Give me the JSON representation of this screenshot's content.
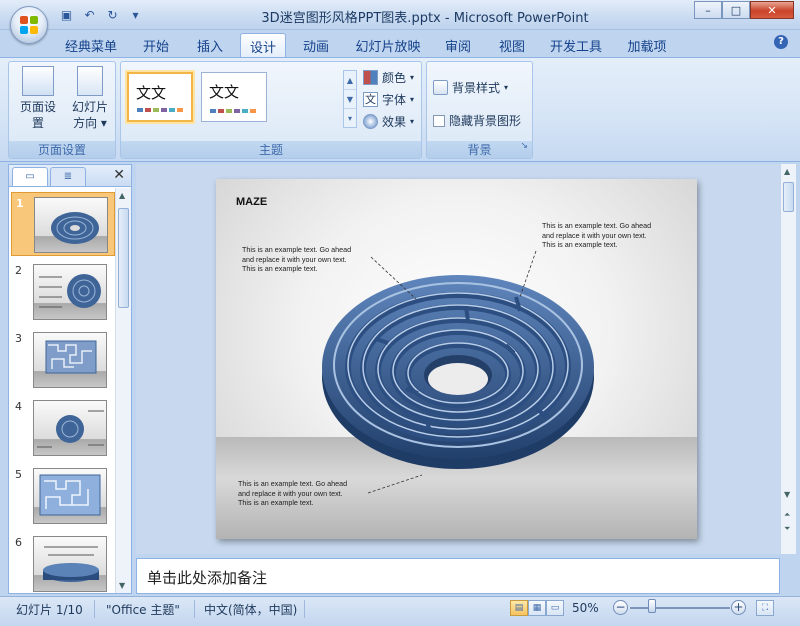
{
  "window": {
    "title": "3D迷宫图形风格PPT图表.pptx - Microsoft PowerPoint"
  },
  "qat": {
    "icons": [
      "save-icon",
      "undo-icon",
      "redo-icon",
      "customize-icon"
    ]
  },
  "ribbon": {
    "tabs": [
      "经典菜单",
      "开始",
      "插入",
      "设计",
      "动画",
      "幻灯片放映",
      "审阅",
      "视图",
      "开发工具",
      "加载项"
    ],
    "active_tab": "设计",
    "page_setup": {
      "page_setup_label": "页面设置",
      "orientation_label": "幻灯片方向",
      "orientation_line1": "幻灯片",
      "orientation_line2": "方向",
      "group_label": "页面设置"
    },
    "themes": {
      "thumb1_text": "文文",
      "thumb2_text": "文文",
      "colors_label": "颜色",
      "fonts_label": "字体",
      "effects_label": "效果",
      "group_label": "主题"
    },
    "background": {
      "styles_label": "背景样式",
      "hide_graphics_label": "隐藏背景图形",
      "group_label": "背景"
    }
  },
  "slides_panel": {
    "tab_slides_icon": "slides-tab-icon",
    "tab_outline_icon": "outline-tab-icon",
    "close_glyph": "✕",
    "numbers": [
      "1",
      "2",
      "3",
      "4",
      "5",
      "6"
    ],
    "selected": 1
  },
  "slide": {
    "title": "MAZE",
    "text_left_top": [
      "This is an example text. Go ahead",
      "and replace it with your own text.",
      "This is an example text."
    ],
    "text_right_top": [
      "This is an example text. Go ahead",
      "and replace it with your own text.",
      "This is an example text."
    ],
    "text_left_bottom": [
      "This is an example text. Go ahead",
      "and replace it with your own text.",
      "This is an example text."
    ]
  },
  "notes": {
    "placeholder": "单击此处添加备注"
  },
  "statusbar": {
    "slide_info": "幻灯片 1/10",
    "theme": "\"Office 主题\"",
    "language": "中文(简体，中国)",
    "zoom": "50%"
  },
  "colors": {
    "accent_orange": "#f2b548",
    "ribbon_blue": "#bfd4ee",
    "maze_blue": "#4a6fa3"
  }
}
